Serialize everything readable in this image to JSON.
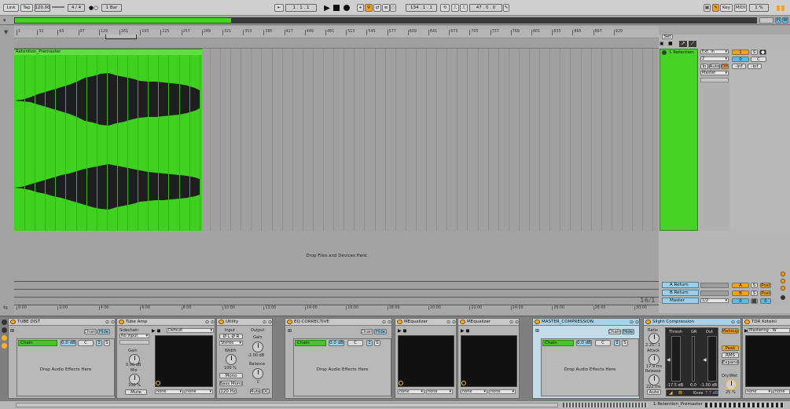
{
  "transport": {
    "link": "Link",
    "tap": "Tap",
    "tempo": "120.00",
    "sig_num": "4",
    "sig_den": "4",
    "metro": "1 Bar",
    "position": "1 .   1 .   1",
    "loop_start": "134 .   1 .   1",
    "loop_length": "47 .   0 .   0",
    "key": "Key",
    "midi": "MIDI",
    "cpu": "1 %",
    "h_label": "H",
    "w_label": "W"
  },
  "ruler": [
    "1",
    "33",
    "65",
    "97",
    "129",
    "161",
    "193",
    "225",
    "257",
    "289",
    "321",
    "353",
    "385",
    "417",
    "449",
    "481",
    "513",
    "545",
    "577",
    "609",
    "641",
    "673",
    "705",
    "737",
    "769",
    "801",
    "833",
    "865",
    "897",
    "929"
  ],
  "timeline": [
    "0:00",
    "2:00",
    "4:00",
    "6:00",
    "8:00",
    "10:00",
    "12:00",
    "14:00",
    "16:00",
    "18:00",
    "20:00",
    "22:00",
    "24:00",
    "26:00",
    "28:00",
    "30:00"
  ],
  "timeline_sig": "16/1",
  "set_label": "Set",
  "clip": {
    "name": "Retention_Premaster"
  },
  "drop_files": "Drop Files and Devices Here",
  "track": {
    "name": "1 Retention",
    "input": "Ext. In",
    "channel": "2",
    "monitor_in": "In",
    "monitor_auto": "Auto",
    "monitor_off": "Off",
    "output": "Master",
    "number": "1",
    "solo": "S",
    "send_a": "0",
    "send_c": "C",
    "vol": "-inf",
    "pan": "-inf"
  },
  "returns": [
    {
      "name": "A Return",
      "letter": "A",
      "solo": "S",
      "post": "Post"
    },
    {
      "name": "B Return",
      "letter": "B",
      "solo": "S",
      "post": "Post"
    },
    {
      "name": "Master",
      "letter": "0",
      "solo": "0",
      "post": "",
      "routing": "1/2"
    }
  ],
  "devices": {
    "tube_dist": {
      "title": "TUBE DIST",
      "chain": "Chain",
      "hide": "Hide",
      "chain_label": "Chain",
      "db": "0.0 dB",
      "c": "C",
      "drop": "Drop Audio Effects Here"
    },
    "tube_amp": {
      "title": "Tube Amp",
      "sidechain": "Sidechain",
      "no_input": "No Input",
      "gain": "Gain",
      "gain_val": "0.00 dB",
      "mix": "Mix",
      "mix_val": "100 %",
      "mute": "Mute",
      "preset": "Default",
      "none1": "none",
      "none2": "none"
    },
    "utility": {
      "title": "Utility",
      "input": "Input",
      "output": "Output",
      "lr": "Ø L  Ø R",
      "stereo": "Stereo",
      "width": "Width",
      "width_val": "100 %",
      "mono": "Mono",
      "bass_mono": "Bass Mono",
      "freq": "120 Hz",
      "gain": "Gain",
      "gain_val": "-2.00 dB",
      "balance": "Balance",
      "bal_val": "C",
      "mute": "Mute",
      "dc": "DC"
    },
    "eq_corrective": {
      "title": "EQ CORRECTIVE",
      "chain": "Chain",
      "hide": "Hide",
      "chain_label": "Chain",
      "db": "0.0 dB",
      "c": "C",
      "drop": "Drop Audio Effects Here"
    },
    "mequalizer1": {
      "title": "MEqualizer",
      "none1": "none",
      "none2": "none"
    },
    "mequalizer2": {
      "title": "MEqualizer",
      "none1": "none",
      "none2": "none"
    },
    "master_comp": {
      "title": "MASTER_COMPRESSION",
      "chain": "Chain",
      "hide": "Hide",
      "chain_label": "Chain",
      "db": "0.0 dB",
      "c": "C",
      "drop": "Drop Audio Effects Here"
    },
    "glue": {
      "title": "Slight Compression",
      "ratio": "Ratio",
      "ratio_val": "2.25 : 1",
      "attack": "Attack",
      "attack_val": "17.9 ms",
      "release": "Release",
      "release_val": "222 ms",
      "auto": "Auto",
      "thresh": "Thresh",
      "gr": "GR",
      "out": "Out",
      "thresh_val": "-17.5 dB",
      "gr_val": "0.0",
      "out_val": "-1.00 dB",
      "knee": "Knee",
      "knee_val": "7.7 dB",
      "makeup": "Makeup",
      "peak": "Peak",
      "rms": "RMS",
      "expand": "Expand",
      "drywet": "Dry/Wet",
      "drywet_val": "25 %"
    },
    "tdr": {
      "title": "TDR Kotelni",
      "preset": "Mastering - W",
      "none1": "none",
      "none2": "none"
    }
  },
  "status": {
    "clip": "1-Retention_Premaster"
  }
}
